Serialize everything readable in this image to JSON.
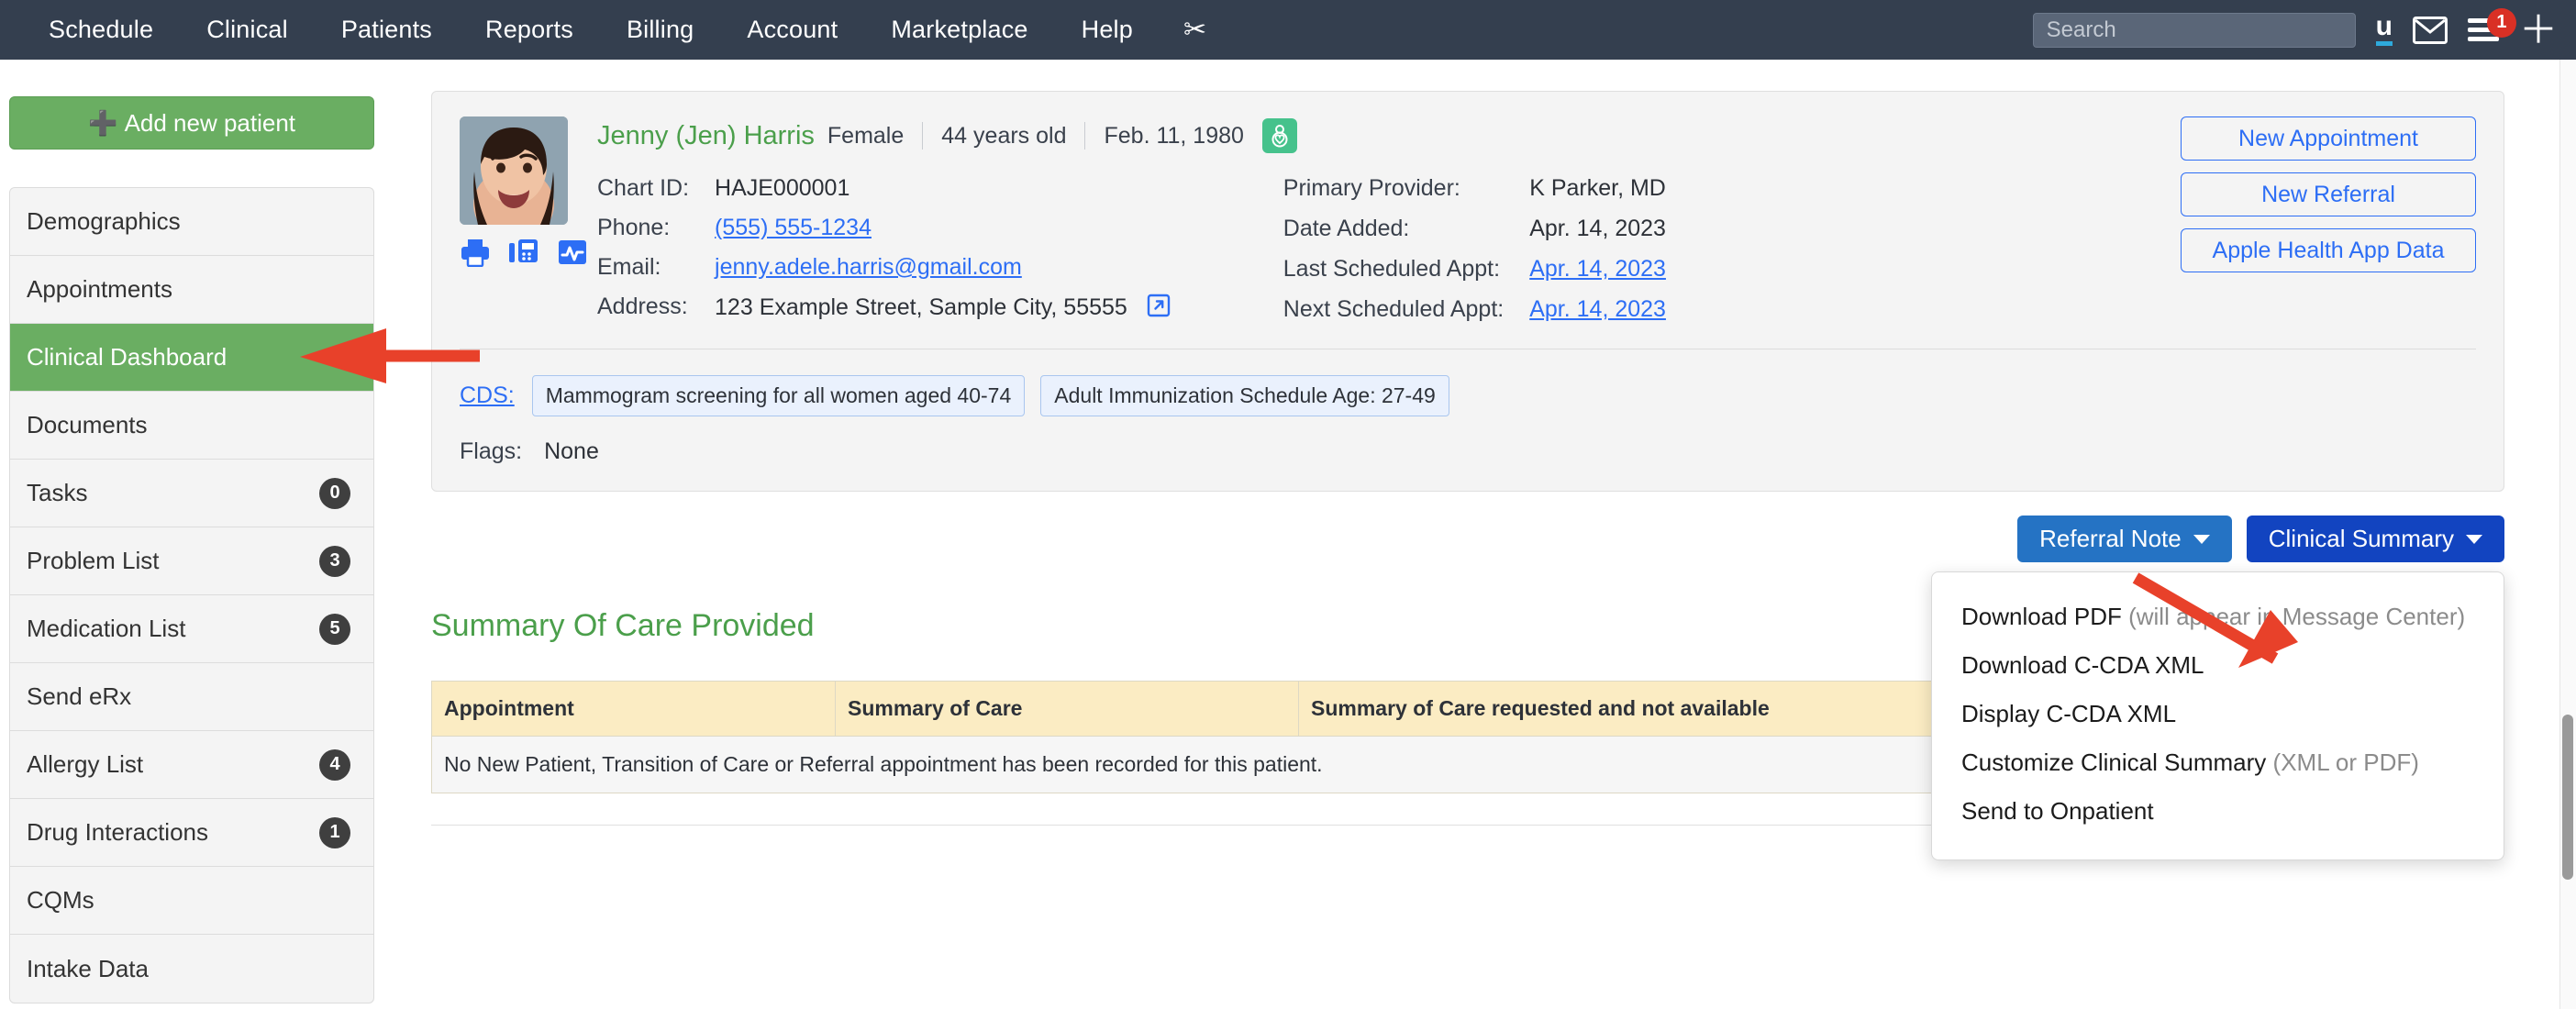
{
  "topnav": {
    "links": [
      "Schedule",
      "Clinical",
      "Patients",
      "Reports",
      "Billing",
      "Account",
      "Marketplace",
      "Help"
    ],
    "scissors_icon": "scissors-icon",
    "search_placeholder": "Search",
    "search_value": "",
    "u_icon_label": "u",
    "message_icon": "envelope-icon",
    "menu_icon": "hamburger-menu-icon",
    "menu_badge": "1",
    "add_icon": "plus-icon",
    "background": "#343f4f"
  },
  "sidebar": {
    "add_patient_label": "Add new patient",
    "items": [
      {
        "label": "Demographics",
        "count": "",
        "active": false
      },
      {
        "label": "Appointments",
        "count": "",
        "active": false
      },
      {
        "label": "Clinical Dashboard",
        "count": "",
        "active": true
      },
      {
        "label": "Documents",
        "count": "",
        "active": false
      },
      {
        "label": "Tasks",
        "count": "0",
        "active": false
      },
      {
        "label": "Problem List",
        "count": "3",
        "active": false
      },
      {
        "label": "Medication List",
        "count": "5",
        "active": false
      },
      {
        "label": "Send eRx",
        "count": "",
        "active": false
      },
      {
        "label": "Allergy List",
        "count": "4",
        "active": false
      },
      {
        "label": "Drug Interactions",
        "count": "1",
        "active": false
      },
      {
        "label": "CQMs",
        "count": "",
        "active": false
      },
      {
        "label": "Intake Data",
        "count": "",
        "active": false
      }
    ],
    "active_color": "#6aae62"
  },
  "patient": {
    "name": "Jenny (Jen) Harris",
    "gender": "Female",
    "age": "44 years old",
    "dob": "Feb. 11, 1980",
    "gender_badge_icon": "female-patient-icon",
    "avatar_icon": "patient-photo",
    "action_icons": [
      "print-icon",
      "fax-icon",
      "vitals-chart-icon"
    ],
    "left_fields": [
      {
        "label": "Chart ID:",
        "value": "HAJE000001",
        "link": false
      },
      {
        "label": "Phone:",
        "value": "(555) 555-1234",
        "link": true
      },
      {
        "label": "Email:",
        "value": "jenny.adele.harris@gmail.com",
        "link": true
      },
      {
        "label": "Address:",
        "value": "123 Example Street, Sample City, 55555",
        "link": false
      }
    ],
    "address_external_link_icon": "external-link-icon",
    "right_fields": [
      {
        "label": "Primary Provider:",
        "value": "K Parker, MD",
        "link": false
      },
      {
        "label": "Date Added:",
        "value": "Apr. 14, 2023",
        "link": false
      },
      {
        "label": "Last Scheduled Appt:",
        "value": "Apr. 14, 2023",
        "link": true
      },
      {
        "label": "Next Scheduled Appt:",
        "value": "Apr. 14, 2023",
        "link": true
      }
    ],
    "action_buttons": [
      "New Appointment",
      "New Referral",
      "Apple Health App Data"
    ],
    "cds_label": "CDS:",
    "cds_chips": [
      "Mammogram screening for all women aged 40-74",
      "Adult Immunization Schedule Age: 27-49"
    ],
    "flags_label": "Flags:",
    "flags_value": "None"
  },
  "toolbar": {
    "referral_note_label": "Referral Note",
    "clinical_summary_label": "Clinical Summary",
    "caret_icon": "caret-down-icon"
  },
  "dropdown": {
    "items": [
      {
        "main": "Download PDF",
        "note": "(will appear in Message Center)"
      },
      {
        "main": "Download C-CDA XML",
        "note": ""
      },
      {
        "main": "Display C-CDA XML",
        "note": ""
      },
      {
        "main": "Customize Clinical Summary",
        "note": "(XML or PDF)"
      },
      {
        "main": "Send to Onpatient",
        "note": ""
      }
    ]
  },
  "summary": {
    "title": "Summary Of Care Provided",
    "columns": [
      "Appointment",
      "Summary of Care",
      "Summary of Care requested and not available"
    ],
    "empty_message": "No New Patient, Transition of Care or Referral appointment has been recorded for this patient."
  },
  "annotations": {
    "arrow_color": "#e8412a",
    "arrow_sidebar_target": "Clinical Dashboard",
    "arrow_summary_target": "Clinical Summary"
  }
}
